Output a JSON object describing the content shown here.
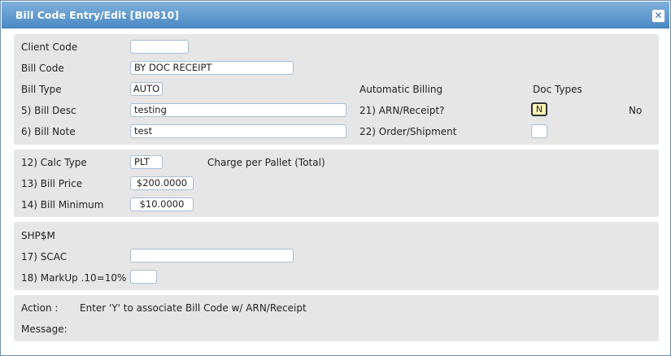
{
  "window": {
    "title": "Bill Code Entry/Edit [BI0810]",
    "close_glyph": "✕"
  },
  "section1": {
    "client_code": {
      "label": "Client Code",
      "value": ""
    },
    "bill_code": {
      "label": "Bill Code",
      "value": "BY DOC RECEIPT"
    },
    "bill_type": {
      "label": "Bill Type",
      "value": "AUTO"
    },
    "bill_desc": {
      "label": "5) Bill Desc",
      "value": "testing"
    },
    "bill_note": {
      "label": "6) Bill Note",
      "value": "test"
    },
    "automatic_billing_header": "Automatic Billing",
    "doc_types_header": "Doc Types",
    "arn_receipt": {
      "label": "21) ARN/Receipt?",
      "value": "N",
      "doc_type": "No"
    },
    "order_shipment": {
      "label": "22) Order/Shipment",
      "value": ""
    }
  },
  "section2": {
    "calc_type": {
      "label": "12) Calc Type",
      "value": "PLT",
      "description": "Charge per Pallet (Total)"
    },
    "bill_price": {
      "label": "13) Bill Price",
      "value": "$200.0000"
    },
    "bill_minimum": {
      "label": "14) Bill Minimum",
      "value": "$10.0000"
    }
  },
  "section3": {
    "header": "SHP$M",
    "scac": {
      "label": "17) SCAC",
      "value": ""
    },
    "markup": {
      "label": "18) MarkUp .10=10%",
      "value": ""
    }
  },
  "section4": {
    "action_label": "Action :",
    "action_text": "Enter 'Y' to associate Bill Code w/ ARN/Receipt",
    "message_label": "Message:",
    "message_text": ""
  },
  "colors": {
    "title_bar": "#4a8ac4",
    "panel": "#e6e6e6",
    "input_border": "#a9bfd6",
    "active_field": "#fff6b8"
  }
}
